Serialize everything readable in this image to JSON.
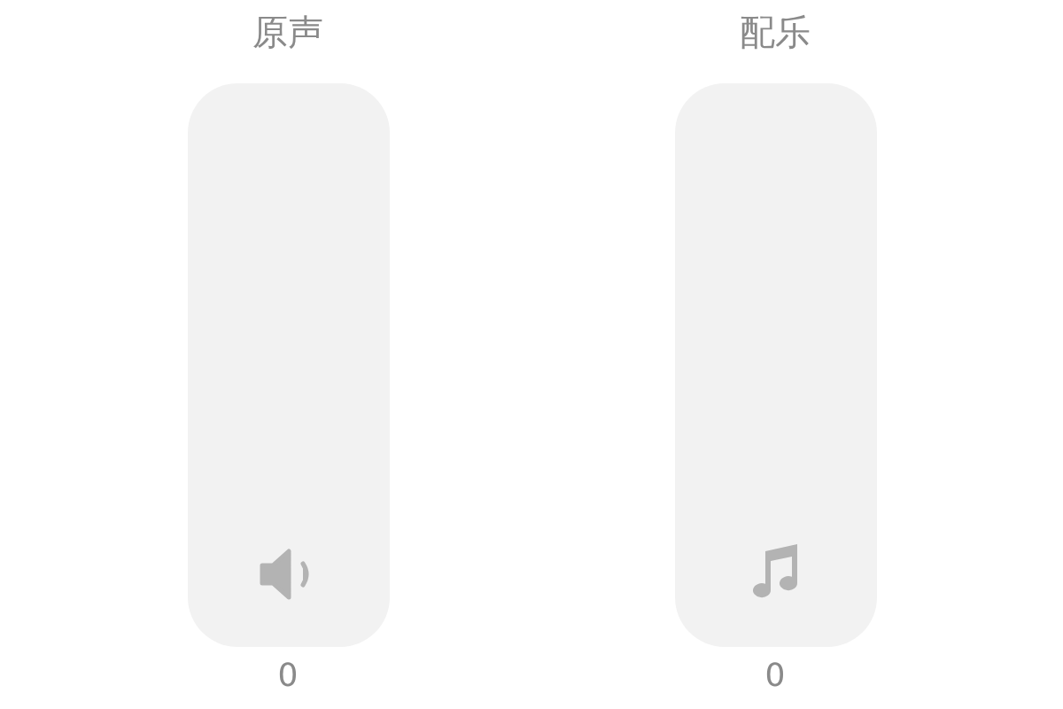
{
  "sliders": [
    {
      "label": "原声",
      "kind": "voice",
      "level": 0,
      "value": "0"
    },
    {
      "label": "配乐",
      "kind": "music",
      "level": 0,
      "value": "0"
    }
  ]
}
